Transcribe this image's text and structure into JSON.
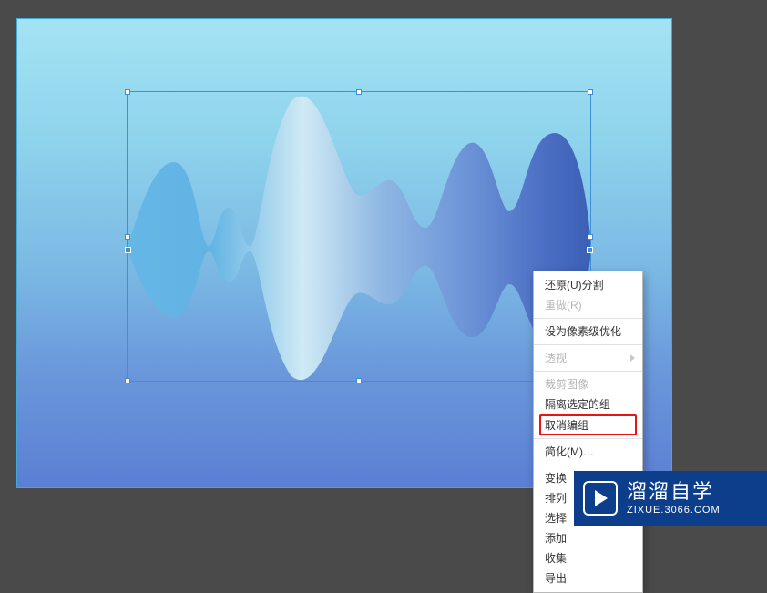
{
  "context_menu": {
    "undo": "还原(U)分割",
    "redo": "重做(R)",
    "pixel_opt": "设为像素级优化",
    "perspective": "透视",
    "crop": "裁剪图像",
    "isolate": "隔离选定的组",
    "ungroup": "取消编组",
    "simplify": "简化(M)…",
    "transform": "变换",
    "arrange": "排列",
    "select": "选择",
    "add": "添加",
    "collect": "收集",
    "export": "导出"
  },
  "watermark": {
    "title": "溜溜自学",
    "url": "ZIXUE.3066.COM"
  }
}
